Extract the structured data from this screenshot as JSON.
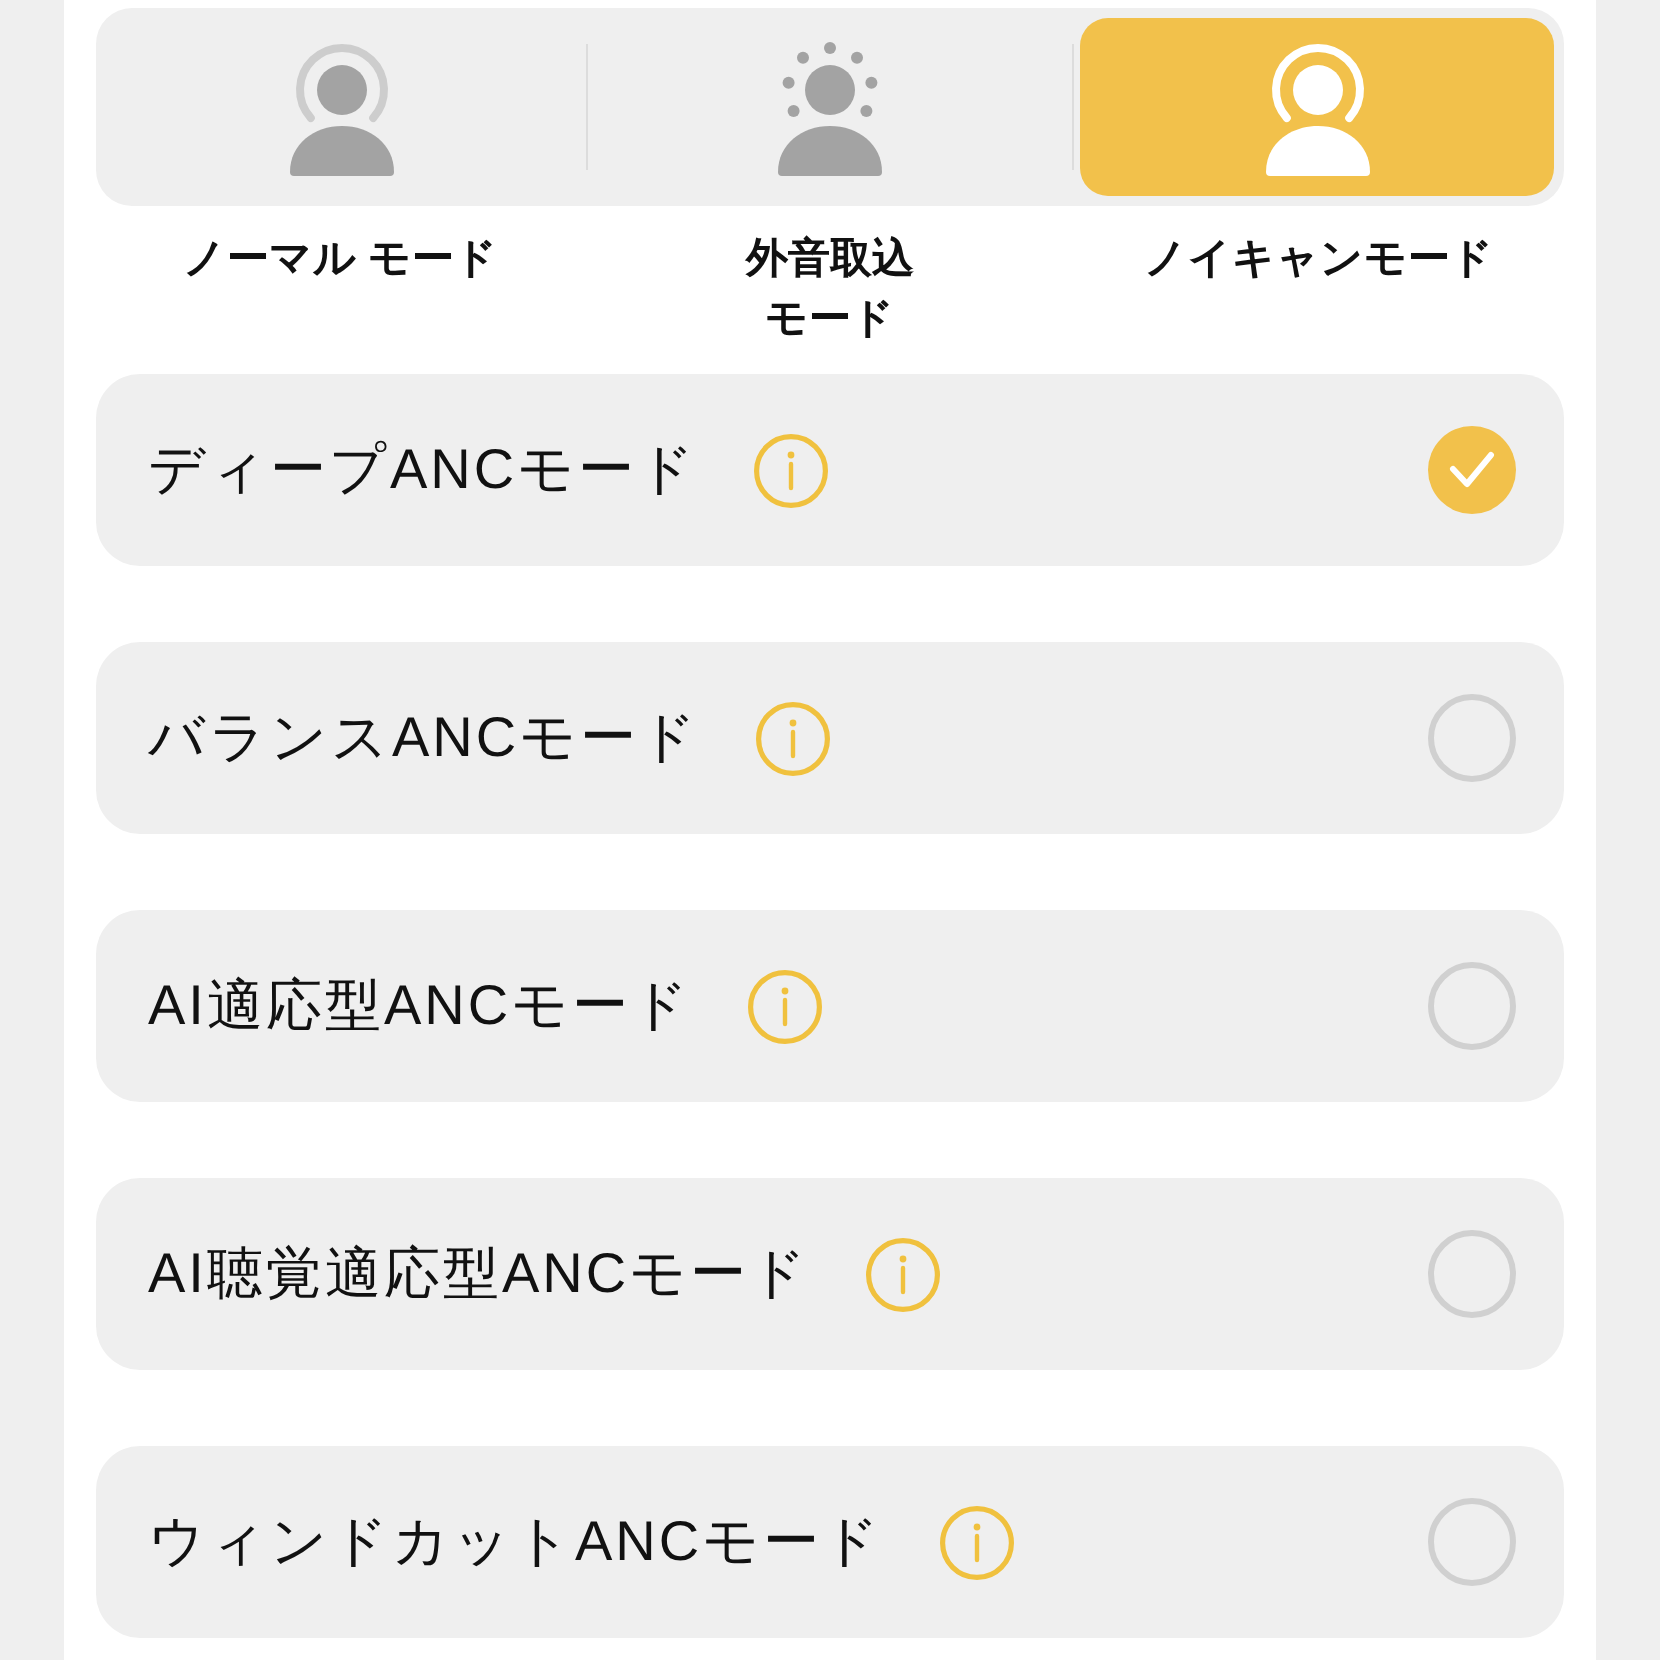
{
  "mode_selector": {
    "modes": [
      {
        "kind": "normal",
        "label": "ノーマル モード",
        "selected": false
      },
      {
        "kind": "ambient",
        "label": "外音取込モード",
        "selected": false
      },
      {
        "kind": "anc",
        "label": "ノイキャンモード",
        "selected": true
      }
    ]
  },
  "options": [
    {
      "label": "ディープANCモード",
      "selected": true
    },
    {
      "label": "バランスANCモード",
      "selected": false
    },
    {
      "label": "AI適応型ANCモード",
      "selected": false
    },
    {
      "label": "AI聴覚適応型ANCモード",
      "selected": false
    },
    {
      "label": "ウィンドカットANCモード",
      "selected": false
    }
  ]
}
